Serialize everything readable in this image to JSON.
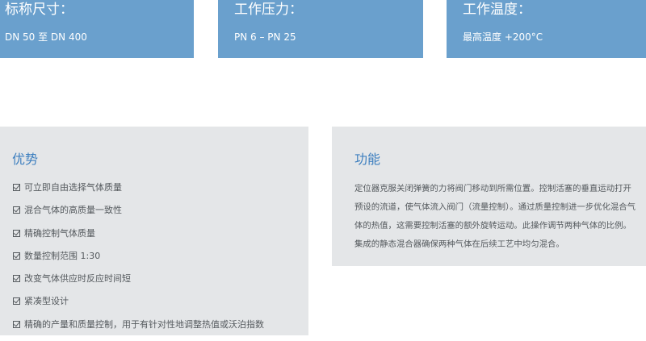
{
  "spec_cards": {
    "size": {
      "title": "标称尺寸：",
      "value": "DN 50 至 DN 400"
    },
    "pressure": {
      "title": "工作压力：",
      "value": "PN 6 – PN 25"
    },
    "temperature": {
      "title": "工作温度：",
      "value": "最高温度 +200°C"
    }
  },
  "advantages": {
    "title": "优势",
    "items": [
      "可立即自由选择气体质量",
      "混合气体的高质量一致性",
      "精确控制气体质量",
      "数量控制范围 1:30",
      "改变气体供应时反应时间短",
      "紧凑型设计",
      "精确的产量和质量控制，用于有针对性地调整热值或沃泊指数"
    ]
  },
  "function": {
    "title": "功能",
    "text": "定位器克服关闭弹簧的力将阀门移动到所需位置。控制活塞的垂直运动打开预设的流道，使气体流入阀门（流量控制）。通过质量控制进一步优化混合气体的热值，这需要控制活塞的额外旋转运动。此操作调节两种气体的比例。集成的静态混合器确保两种气体在后续工艺中均匀混合。"
  },
  "colors": {
    "card_bg": "#6aa0cd",
    "panel_bg": "#e4e6e8",
    "heading_blue": "#3d7fbf",
    "body_text": "#555a5e"
  }
}
